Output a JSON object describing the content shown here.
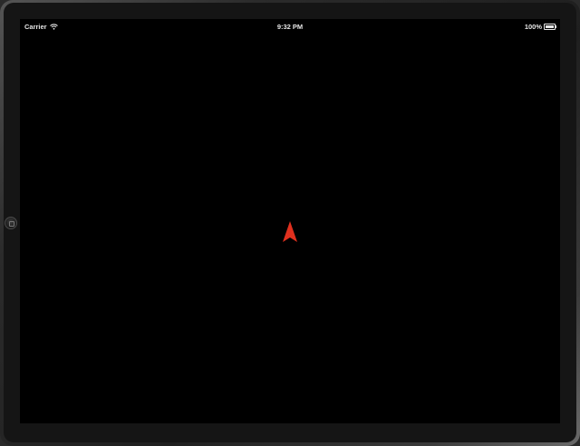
{
  "status_bar": {
    "carrier": "Carrier",
    "time": "9:32 PM",
    "battery_percent": "100%",
    "icons": {
      "wifi": "wifi-icon",
      "battery": "battery-icon"
    }
  },
  "screen": {
    "background": "#000000",
    "location_arrow": {
      "icon": "location-arrow-icon",
      "color": "#e0301e"
    }
  },
  "device": {
    "home_button_icon": "home-button-icon"
  }
}
